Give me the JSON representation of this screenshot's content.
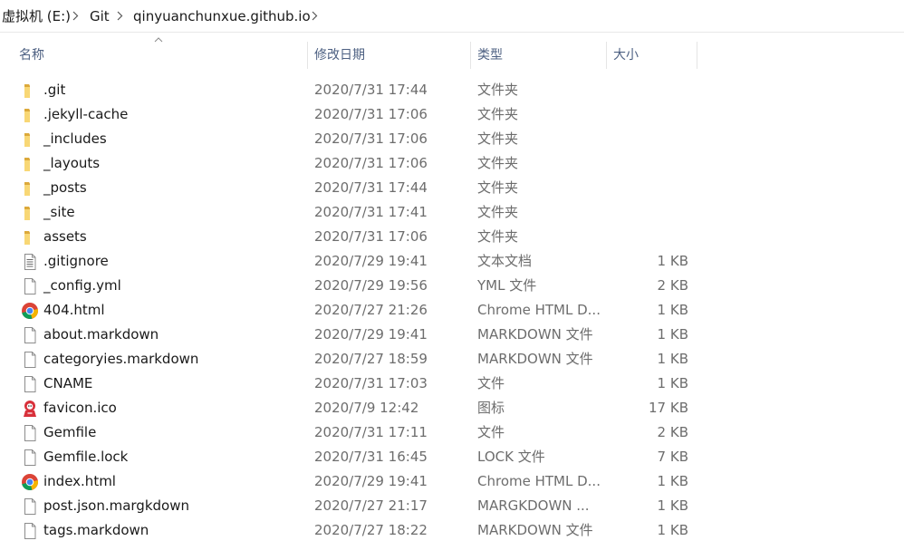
{
  "breadcrumb": {
    "items": [
      "虚拟机 (E:)",
      "Git",
      "qinyuanchunxue.github.io"
    ]
  },
  "columns": {
    "name": "名称",
    "date": "修改日期",
    "type": "类型",
    "size": "大小"
  },
  "files": [
    {
      "name": ".git",
      "date": "2020/7/31 17:44",
      "type": "文件夹",
      "size": "",
      "icon": "folder-icon"
    },
    {
      "name": ".jekyll-cache",
      "date": "2020/7/31 17:06",
      "type": "文件夹",
      "size": "",
      "icon": "folder-icon"
    },
    {
      "name": "_includes",
      "date": "2020/7/31 17:06",
      "type": "文件夹",
      "size": "",
      "icon": "folder-icon"
    },
    {
      "name": "_layouts",
      "date": "2020/7/31 17:06",
      "type": "文件夹",
      "size": "",
      "icon": "folder-icon"
    },
    {
      "name": "_posts",
      "date": "2020/7/31 17:44",
      "type": "文件夹",
      "size": "",
      "icon": "folder-icon"
    },
    {
      "name": "_site",
      "date": "2020/7/31 17:41",
      "type": "文件夹",
      "size": "",
      "icon": "folder-icon"
    },
    {
      "name": "assets",
      "date": "2020/7/31 17:06",
      "type": "文件夹",
      "size": "",
      "icon": "folder-icon"
    },
    {
      "name": ".gitignore",
      "date": "2020/7/29 19:41",
      "type": "文本文档",
      "size": "1 KB",
      "icon": "text-document-icon"
    },
    {
      "name": "_config.yml",
      "date": "2020/7/29 19:56",
      "type": "YML 文件",
      "size": "2 KB",
      "icon": "file-icon"
    },
    {
      "name": "404.html",
      "date": "2020/7/27 21:26",
      "type": "Chrome HTML D...",
      "size": "1 KB",
      "icon": "chrome-icon"
    },
    {
      "name": "about.markdown",
      "date": "2020/7/29 19:41",
      "type": "MARKDOWN 文件",
      "size": "1 KB",
      "icon": "file-icon"
    },
    {
      "name": "categoryies.markdown",
      "date": "2020/7/27 18:59",
      "type": "MARKDOWN 文件",
      "size": "1 KB",
      "icon": "file-icon"
    },
    {
      "name": "CNAME",
      "date": "2020/7/31 17:03",
      "type": "文件",
      "size": "1 KB",
      "icon": "file-icon"
    },
    {
      "name": "favicon.ico",
      "date": "2020/7/9 12:42",
      "type": "图标",
      "size": "17 KB",
      "icon": "favicon-image-icon"
    },
    {
      "name": "Gemfile",
      "date": "2020/7/31 17:11",
      "type": "文件",
      "size": "2 KB",
      "icon": "file-icon"
    },
    {
      "name": "Gemfile.lock",
      "date": "2020/7/31 16:45",
      "type": "LOCK 文件",
      "size": "7 KB",
      "icon": "file-icon"
    },
    {
      "name": "index.html",
      "date": "2020/7/29 19:41",
      "type": "Chrome HTML D...",
      "size": "1 KB",
      "icon": "chrome-icon"
    },
    {
      "name": "post.json.margkdown",
      "date": "2020/7/27 21:17",
      "type": "MARGKDOWN ...",
      "size": "1 KB",
      "icon": "file-icon"
    },
    {
      "name": "tags.markdown",
      "date": "2020/7/27 18:22",
      "type": "MARKDOWN 文件",
      "size": "1 KB",
      "icon": "file-icon"
    }
  ],
  "colors": {
    "folder": "#f8d775",
    "header_text": "#4d6082",
    "secondary_text": "#6d6d6d"
  }
}
